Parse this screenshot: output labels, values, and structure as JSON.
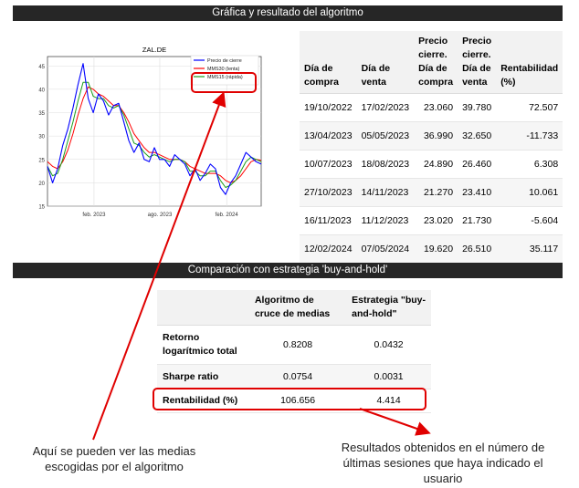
{
  "headers": {
    "chart_section": "Gráfica y resultado del algoritmo",
    "comparison_section": "Comparación con estrategia 'buy-and-hold'"
  },
  "chart_data": {
    "type": "line",
    "title": "ZAL.DE",
    "ylim": [
      15,
      47
    ],
    "yticks": [
      "15",
      "20",
      "25",
      "30",
      "35",
      "40",
      "45"
    ],
    "xticks": [
      "feb. 2023",
      "ago. 2023",
      "feb. 2024"
    ],
    "grid": true,
    "legend_position": "top-right",
    "x": [
      "2022-09-26",
      "2022-10-10",
      "2022-10-24",
      "2022-11-07",
      "2022-11-21",
      "2022-12-05",
      "2022-12-19",
      "2023-01-02",
      "2023-01-16",
      "2023-01-30",
      "2023-02-13",
      "2023-02-27",
      "2023-03-13",
      "2023-03-27",
      "2023-04-10",
      "2023-04-24",
      "2023-05-08",
      "2023-05-22",
      "2023-06-05",
      "2023-06-19",
      "2023-07-03",
      "2023-07-17",
      "2023-07-31",
      "2023-08-14",
      "2023-08-28",
      "2023-09-11",
      "2023-09-25",
      "2023-10-09",
      "2023-10-23",
      "2023-11-06",
      "2023-11-20",
      "2023-12-04",
      "2023-12-18",
      "2024-01-01",
      "2024-01-15",
      "2024-01-29",
      "2024-02-12",
      "2024-02-26",
      "2024-03-11",
      "2024-03-25",
      "2024-04-08",
      "2024-04-22",
      "2024-05-06"
    ],
    "series": [
      {
        "name": "Precio de cierre",
        "color": "#0000ff",
        "values": [
          23.5,
          20.0,
          23.0,
          28.0,
          31.5,
          36.0,
          41.0,
          45.5,
          38.0,
          35.0,
          39.0,
          37.5,
          34.5,
          36.5,
          37.0,
          33.0,
          29.0,
          26.5,
          28.5,
          25.0,
          24.5,
          27.5,
          25.0,
          25.0,
          23.5,
          26.0,
          25.0,
          24.0,
          21.5,
          23.0,
          20.5,
          22.0,
          24.0,
          23.0,
          19.0,
          17.5,
          20.0,
          21.5,
          24.0,
          26.5,
          25.5,
          24.5,
          24.0
        ]
      },
      {
        "name": "MMS30 (lenta)",
        "color": "#ff0000",
        "values": [
          24.5,
          23.5,
          23.0,
          24.5,
          27.0,
          30.5,
          34.5,
          38.0,
          40.5,
          40.0,
          39.0,
          38.5,
          37.5,
          36.5,
          36.5,
          35.0,
          33.0,
          30.5,
          29.0,
          27.5,
          26.5,
          26.5,
          26.0,
          25.5,
          25.0,
          25.0,
          25.0,
          24.5,
          23.5,
          23.0,
          22.5,
          22.0,
          22.0,
          22.0,
          21.5,
          20.5,
          20.0,
          20.5,
          21.5,
          23.0,
          24.5,
          25.0,
          24.8
        ]
      },
      {
        "name": "MMS15 (rápida)",
        "color": "#1a9e1a",
        "values": [
          23.5,
          21.5,
          22.0,
          25.0,
          29.0,
          33.0,
          37.5,
          41.5,
          41.5,
          38.5,
          38.0,
          38.0,
          36.5,
          36.0,
          36.5,
          34.5,
          31.5,
          28.5,
          28.0,
          26.5,
          25.5,
          26.0,
          25.5,
          25.0,
          24.5,
          25.0,
          25.0,
          24.5,
          22.5,
          22.5,
          21.5,
          21.5,
          22.5,
          22.5,
          20.5,
          19.0,
          19.5,
          20.5,
          22.5,
          24.5,
          25.5,
          25.0,
          24.5
        ]
      }
    ]
  },
  "trades": {
    "columns": [
      "Día de compra",
      "Día de venta",
      "Precio cierre. Día de compra",
      "Precio cierre. Día de venta",
      "Rentabilidad (%)"
    ],
    "rows": [
      [
        "19/10/2022",
        "17/02/2023",
        "23.060",
        "39.780",
        "72.507"
      ],
      [
        "13/04/2023",
        "05/05/2023",
        "36.990",
        "32.650",
        "-11.733"
      ],
      [
        "10/07/2023",
        "18/08/2023",
        "24.890",
        "26.460",
        "6.308"
      ],
      [
        "27/10/2023",
        "14/11/2023",
        "21.270",
        "23.410",
        "10.061"
      ],
      [
        "16/11/2023",
        "11/12/2023",
        "23.020",
        "21.730",
        "-5.604"
      ],
      [
        "12/02/2024",
        "07/05/2024",
        "19.620",
        "26.510",
        "35.117"
      ]
    ]
  },
  "comparison": {
    "columns": [
      "",
      "Algoritmo de cruce de medias",
      "Estrategia \"buy-and-hold\""
    ],
    "rows": [
      [
        "Retorno logarítmico total",
        "0.8208",
        "0.0432"
      ],
      [
        "Sharpe ratio",
        "0.0754",
        "0.0031"
      ],
      [
        "Rentabilidad (%)",
        "106.656",
        "4.414"
      ]
    ]
  },
  "annotations": {
    "left_note": "Aquí se pueden ver las medias escogidas por el algoritmo",
    "right_note": "Resultados obtenidos en el número de últimas sesiones que haya indicado el usuario",
    "highlight_color": "#e00000"
  }
}
